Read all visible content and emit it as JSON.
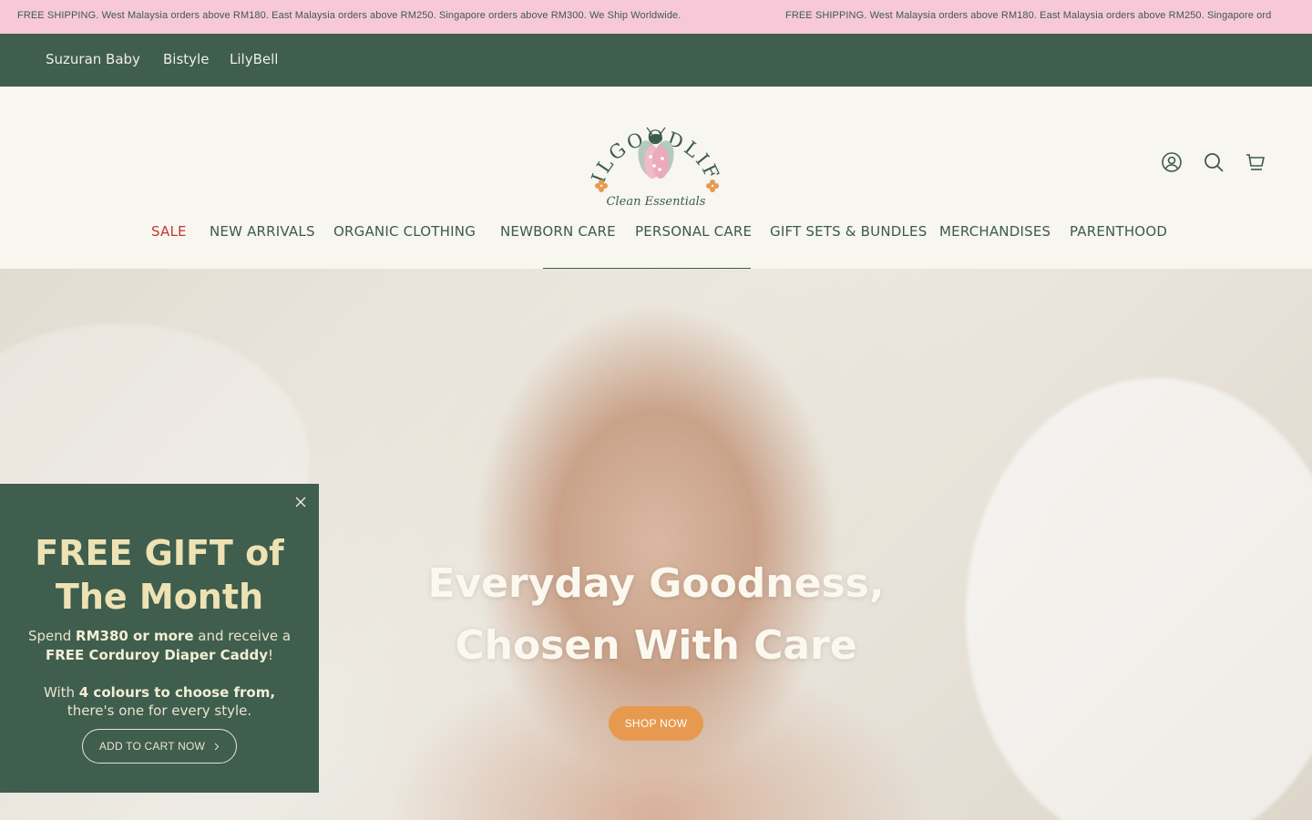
{
  "announcement": {
    "text": "FREE SHIPPING. West Malaysia orders above RM180. East Malaysia orders above RM250. Singapore orders above RM300. We Ship Worldwide.",
    "text_repeat": "FREE SHIPPING. West Malaysia orders above RM180. East Malaysia orders above RM250. Singapore ord"
  },
  "brands": [
    "Suzuran Baby",
    "Bistyle",
    "LilyBell"
  ],
  "logo": {
    "arc_text": "LILGOODLIFE",
    "tagline": "Clean Essentials"
  },
  "header_icons": [
    "account-icon",
    "search-icon",
    "cart-icon"
  ],
  "nav": [
    "SALE",
    "NEW ARRIVALS",
    "ORGANIC CLOTHING",
    "NEWBORN CARE",
    "PERSONAL CARE",
    "GIFT SETS & BUNDLES",
    "MERCHANDISES",
    "PARENTHOOD"
  ],
  "hero": {
    "headline_line1": "Everyday Goodness,",
    "headline_line2": "Chosen With Care",
    "cta": "SHOP NOW"
  },
  "popup": {
    "title_line1": "FREE GIFT of",
    "title_line2": "The Month",
    "line1_pre": "Spend ",
    "line1_bold": "RM380 or more",
    "line1_post": " and receive a",
    "line2_bold": "FREE Corduroy Diaper Caddy",
    "line2_post": "!",
    "line3_pre": "With ",
    "line3_bold": "4 colours to choose from,",
    "line4": "there's one for every style.",
    "cta": "ADD TO CART NOW",
    "close_icon": "close-icon"
  },
  "colors": {
    "announcement_bg": "#f7c9d8",
    "brand_green": "#3f5e4d",
    "page_bg": "#f7f6ef",
    "sale_red": "#c0392b",
    "cta_orange": "#e79a4f",
    "popup_title": "#eee2b4"
  }
}
